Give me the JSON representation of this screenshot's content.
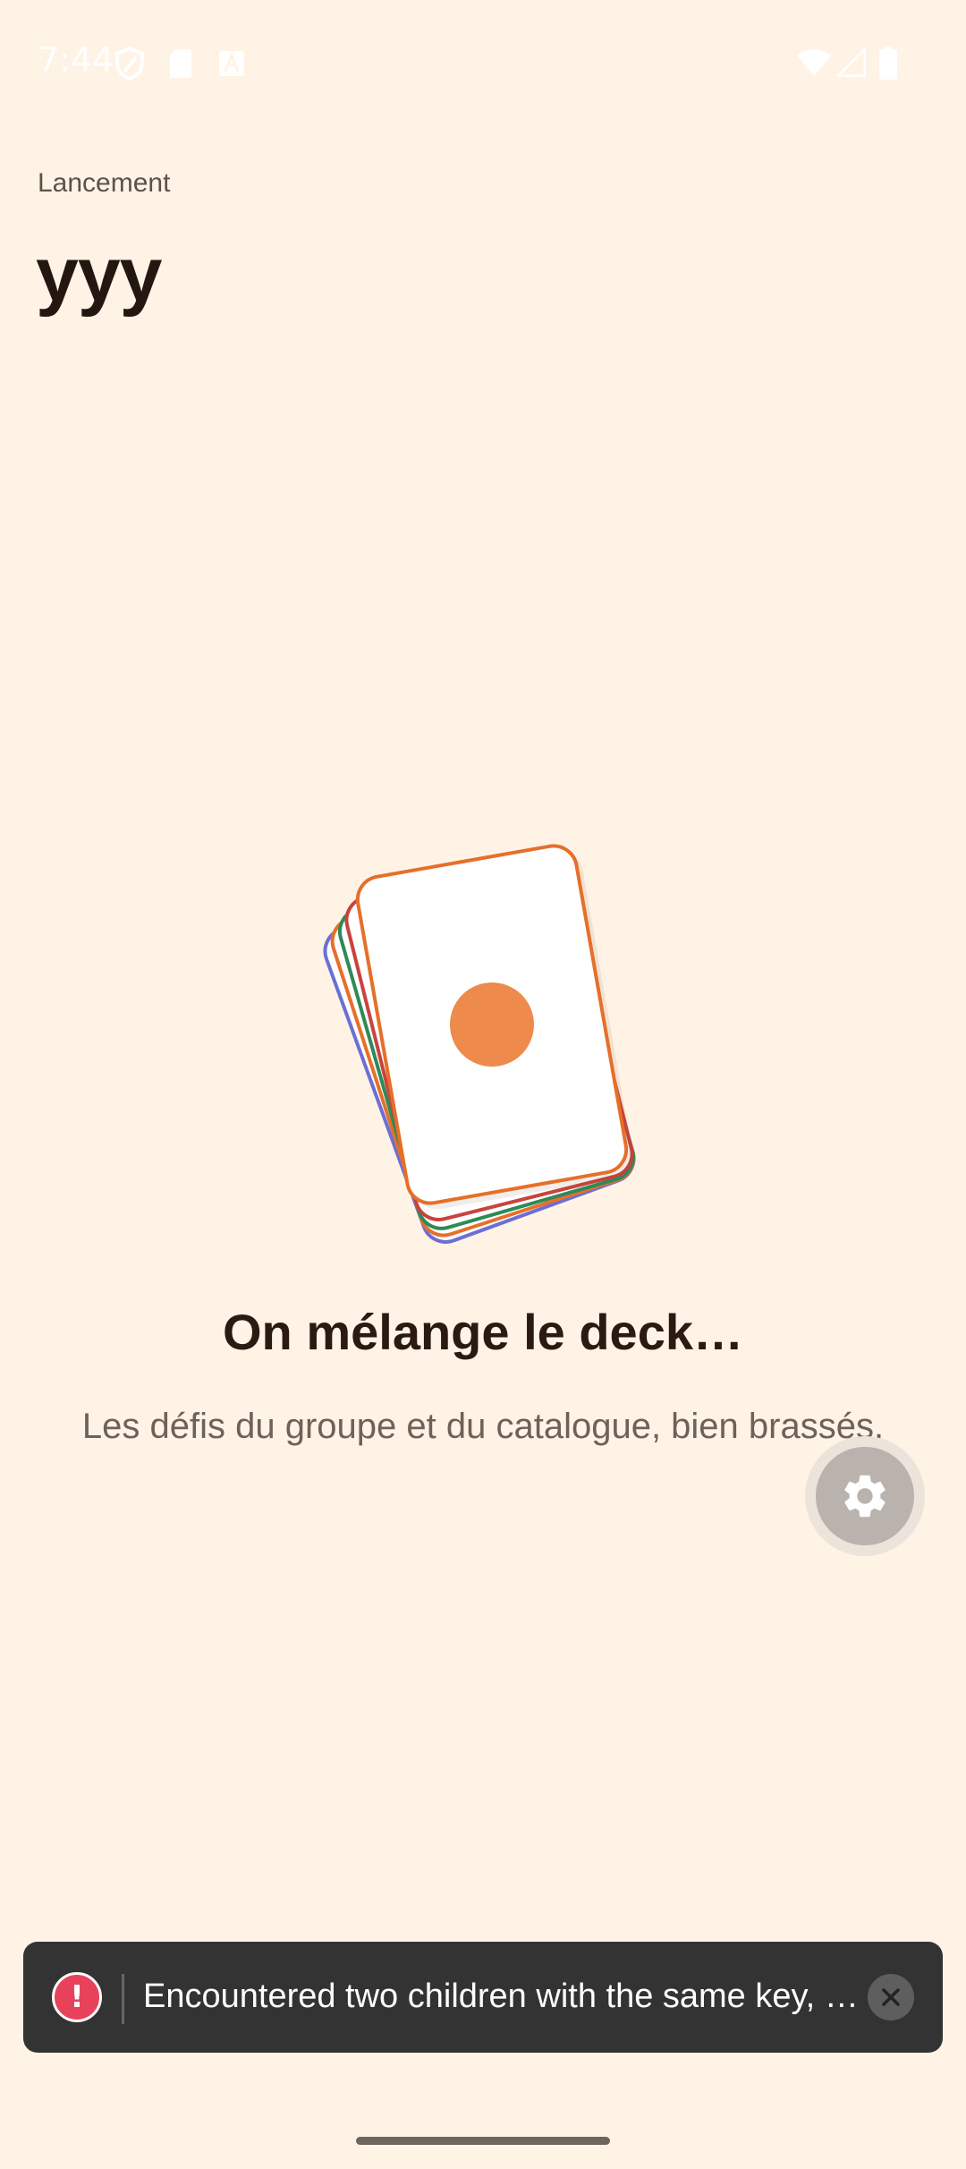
{
  "status_bar": {
    "time": "7:44",
    "icons_left": [
      "shield-icon",
      "sim-card-icon",
      "font-icon"
    ],
    "icons_right": [
      "wifi-icon",
      "cell-signal-icon",
      "battery-icon"
    ]
  },
  "header": {
    "eyebrow": "Lancement",
    "title": "yyy"
  },
  "loading": {
    "illustration": "card-deck-icon",
    "card_colors": [
      "#E66F2A",
      "#C9433E",
      "#2E8A57",
      "#E66F2A",
      "#6B6FD4"
    ],
    "dot_color": "#EE8A4B",
    "heading": "On mélange le deck…",
    "subtitle": "Les défis du groupe et du catalogue, bien brassés."
  },
  "fab": {
    "icon": "gear-icon"
  },
  "toast": {
    "icon": "error-icon",
    "icon_glyph": "!",
    "message": "Encountered two children with the same key, `#…",
    "close_icon": "close-icon"
  },
  "colors": {
    "background": "#FFF3E6",
    "accent": "#E66F2A",
    "toast_bg": "#333333",
    "error": "#E8425B"
  }
}
